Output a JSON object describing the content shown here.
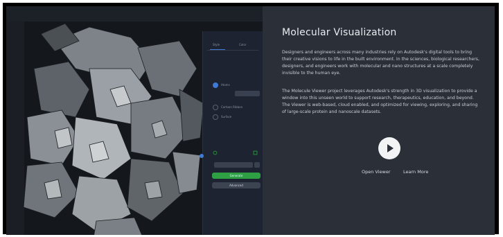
{
  "info": {
    "title": "Molecular Visualization",
    "paragraph1": "Designers and engineers across many industries rely on Autodesk's digital tools to bring their creative visions to life in the built environment. In the sciences, biological researchers, designers, and engineers work with molecular and nano structures at a scale completely invisible to the human eye.",
    "paragraph2": "The Molecule Viewer project leverages Autodesk's strength in 3D visualization to provide a window into this unseen world to support research, therapeutics, education, and beyond. The Viewer is web-based, cloud enabled, and optimized for viewing, exploring, and sharing of large-scale protein and nanoscale datasets.",
    "open_viewer_label": "Open Viewer",
    "learn_more_label": "Learn More",
    "play_icon": "play-icon"
  },
  "panel": {
    "tab1": "Style",
    "tab2": "Color",
    "option1": "Atoms",
    "option2": "Cartoon Ribbon",
    "option3": "Surface",
    "primary_button": "Generate",
    "secondary_button": "Advanced"
  },
  "colors": {
    "accent_blue": "#3f7bd6",
    "accent_green": "#2ea043",
    "background": "#2b3038"
  }
}
